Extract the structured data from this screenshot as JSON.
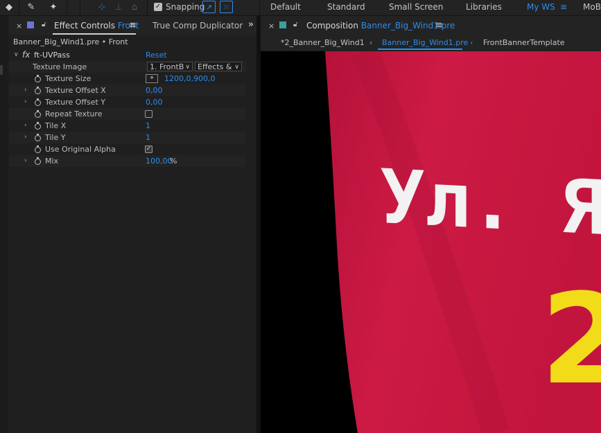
{
  "toolbar": {
    "snapping_label": "Snapping",
    "snapping_checked": true,
    "workspaces": [
      "Default",
      "Standard",
      "Small Screen",
      "Libraries",
      "My WS",
      "MoBI"
    ],
    "active_workspace": "My WS",
    "menu_icon": "≡"
  },
  "effect_panel": {
    "tab_title": "Effect Controls",
    "tab_layer": "Front",
    "other_tab": "True Comp Duplicator",
    "breadcrumb": "Banner_Big_Wind1.pre • Front",
    "effect_name": "ft-UVPass",
    "reset_label": "Reset",
    "params": {
      "texture_image": {
        "label": "Texture Image",
        "layer": "1. FrontB",
        "source": "Effects &"
      },
      "texture_size": {
        "label": "Texture Size",
        "value": "1200,0,900,0"
      },
      "texture_offset_x": {
        "label": "Texture Offset X",
        "value": "0,00"
      },
      "texture_offset_y": {
        "label": "Texture Offset Y",
        "value": "0,00"
      },
      "repeat_texture": {
        "label": "Repeat Texture",
        "checked": false
      },
      "tile_x": {
        "label": "Tile X",
        "value": "1"
      },
      "tile_y": {
        "label": "Tile Y",
        "value": "1"
      },
      "use_original_alpha": {
        "label": "Use Original Alpha",
        "checked": true
      },
      "mix": {
        "label": "Mix",
        "value": "100,00",
        "unit": "%"
      }
    }
  },
  "comp_panel": {
    "tab_prefix": "Composition",
    "comp_name": "Banner_Big_Wind1.pre",
    "flow": [
      "*2_Banner_Big_Wind1",
      "Banner_Big_Wind1.pre",
      "FrontBannerTemplate"
    ],
    "banner_text": "Ул. Яс",
    "banner_number": "2",
    "colors": {
      "banner": "#c8163f",
      "text": "#f2f2f2",
      "number": "#f2dc1a",
      "accent": "#2d8ceb"
    }
  }
}
